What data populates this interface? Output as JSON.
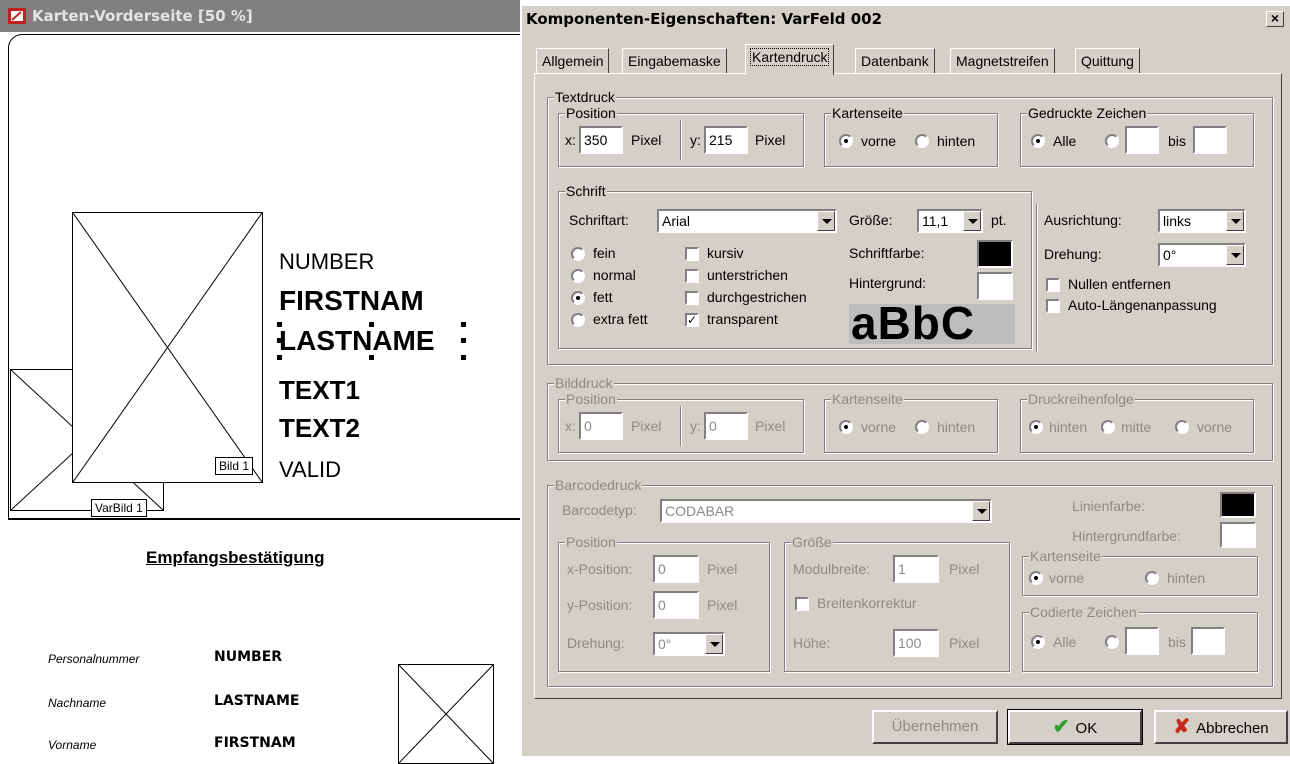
{
  "left_window": {
    "title": "Karten-Vorderseite [50 %]",
    "placeholders": {
      "bild1": "Bild 1",
      "varbild1": "VarBild 1"
    },
    "card_fields": [
      "NUMBER",
      "FIRSTNAM",
      "LASTNAME",
      "TEXT1",
      "TEXT2",
      "VALID"
    ],
    "receipt": {
      "title": "Empfangsbestätigung",
      "rows": [
        {
          "label": "Personalnummer",
          "value": "NUMBER"
        },
        {
          "label": "Nachname",
          "value": "LASTNAME"
        },
        {
          "label": "Vorname",
          "value": "FIRSTNAM"
        }
      ]
    }
  },
  "dialog": {
    "title": "Komponenten-Eigenschaften: VarFeld 002",
    "close_glyph": "×",
    "tabs": [
      "Allgemein",
      "Eingabemaske",
      "Kartendruck",
      "Datenbank",
      "Magnetstreifen",
      "Quittung"
    ],
    "active_tab": "Kartendruck",
    "textdruck": {
      "title": "Textdruck",
      "position": {
        "title": "Position",
        "x_label": "x:",
        "x_value": "350",
        "y_label": "y:",
        "y_value": "215",
        "unit": "Pixel"
      },
      "kartenseite": {
        "title": "Kartenseite",
        "options": [
          "vorne",
          "hinten"
        ],
        "selected": "vorne"
      },
      "gedruckte_zeichen": {
        "title": "Gedruckte Zeichen",
        "option_all": "Alle",
        "bis_label": "bis",
        "selected": "Alle"
      },
      "schrift": {
        "title": "Schrift",
        "schriftart_label": "Schriftart:",
        "schriftart_value": "Arial",
        "groesse_label": "Größe:",
        "groesse_value": "11,1",
        "groesse_unit": "pt.",
        "weights": [
          "fein",
          "normal",
          "fett",
          "extra fett"
        ],
        "weight_selected": "fett",
        "styles": [
          {
            "label": "kursiv",
            "checked": false
          },
          {
            "label": "unterstrichen",
            "checked": false
          },
          {
            "label": "durchgestrichen",
            "checked": false
          },
          {
            "label": "transparent",
            "checked": true
          }
        ],
        "schriftfarbe_label": "Schriftfarbe:",
        "schriftfarbe_color": "#000000",
        "hintergrund_label": "Hintergrund:",
        "hintergrund_color": "#ffffff",
        "preview_text": "aBbC"
      },
      "ausrichtung_label": "Ausrichtung:",
      "ausrichtung_value": "links",
      "drehung_label": "Drehung:",
      "drehung_value": "0°",
      "nullen_label": "Nullen entfernen",
      "auto_laenge_label": "Auto-Längenanpassung"
    },
    "bilddruck": {
      "title": "Bilddruck",
      "position": {
        "title": "Position",
        "x_label": "x:",
        "x_value": "0",
        "y_label": "y:",
        "y_value": "0",
        "unit": "Pixel"
      },
      "kartenseite": {
        "title": "Kartenseite",
        "options": [
          "vorne",
          "hinten"
        ],
        "selected": "vorne"
      },
      "reihenfolge": {
        "title": "Druckreihenfolge",
        "options": [
          "hinten",
          "mitte",
          "vorne"
        ],
        "selected": "hinten"
      }
    },
    "barcodedruck": {
      "title": "Barcodedruck",
      "typ_label": "Barcodetyp:",
      "typ_value": "CODABAR",
      "linienfarbe_label": "Linienfarbe:",
      "linienfarbe_color": "#000000",
      "hintergrundfarbe_label": "Hintergrundfarbe:",
      "hintergrundfarbe_color": "#ffffff",
      "position": {
        "title": "Position",
        "xpos_label": "x-Position:",
        "xpos_value": "0",
        "ypos_label": "y-Position:",
        "ypos_value": "0",
        "unit": "Pixel",
        "drehung_label": "Drehung:",
        "drehung_value": "0°"
      },
      "groesse": {
        "title": "Größe",
        "modul_label": "Modulbreite:",
        "modul_value": "1",
        "breitenkorrektur_label": "Breitenkorrektur",
        "hoehe_label": "Höhe:",
        "hoehe_value": "100",
        "unit": "Pixel"
      },
      "kartenseite": {
        "title": "Kartenseite",
        "options": [
          "vorne",
          "hinten"
        ],
        "selected": "vorne"
      },
      "codierte_zeichen": {
        "title": "Codierte Zeichen",
        "option_all": "Alle",
        "bis_label": "bis"
      }
    },
    "buttons": {
      "apply": "Übernehmen",
      "ok": "OK",
      "cancel": "Abbrechen"
    }
  }
}
